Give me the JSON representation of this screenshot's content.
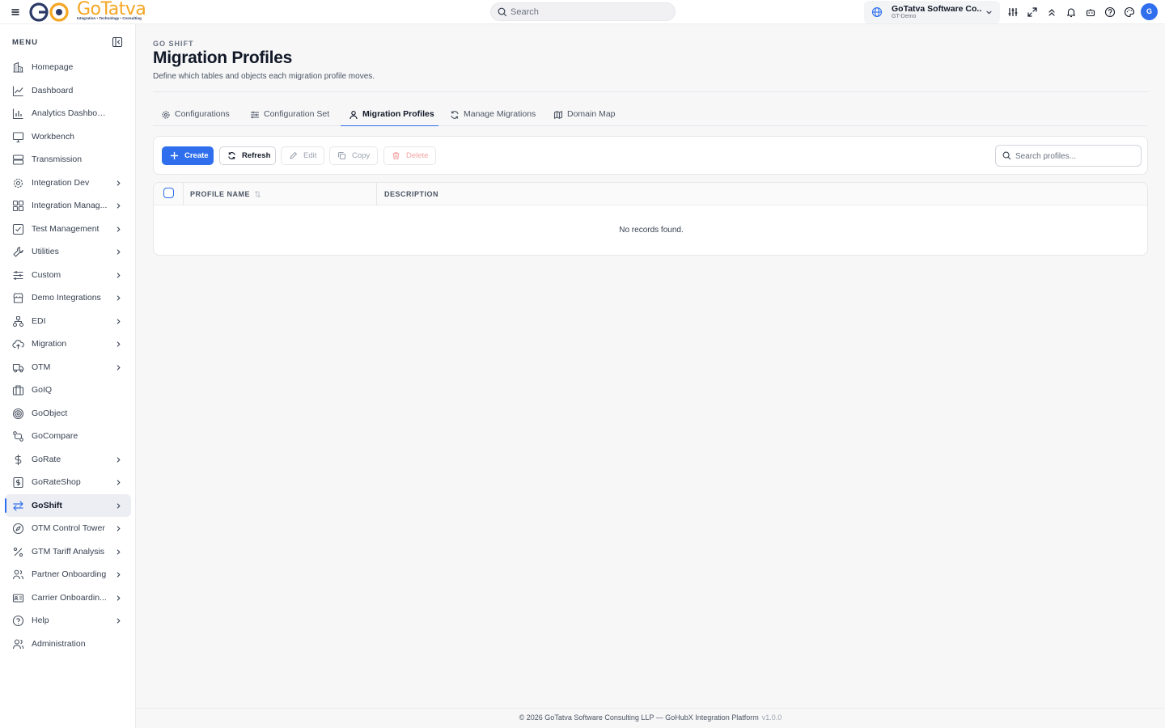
{
  "brand": {
    "logo_text": "GoTatva",
    "tagline": "Integration • Technology • Consulting",
    "accent": "#f5a623",
    "primary": "#2f6fed"
  },
  "topbar": {
    "search_placeholder": "Search",
    "org_name": "GoTatva Software Co...",
    "org_env": "GT-Demo",
    "avatar_initial": "G",
    "icons": [
      "sliders-icon",
      "expand-icon",
      "double-chevron-up-icon",
      "bell-icon",
      "robot-icon",
      "help-icon",
      "palette-icon"
    ]
  },
  "sidebar": {
    "title": "MENU",
    "items": [
      {
        "label": "Homepage",
        "icon": "building-icon",
        "expandable": false
      },
      {
        "label": "Dashboard",
        "icon": "line-chart-icon",
        "expandable": false
      },
      {
        "label": "Analytics Dashboard",
        "icon": "bar-chart-icon",
        "expandable": false
      },
      {
        "label": "Workbench",
        "icon": "monitor-icon",
        "expandable": false
      },
      {
        "label": "Transmission",
        "icon": "server-icon",
        "expandable": false
      },
      {
        "label": "Integration Dev",
        "icon": "gear-icon",
        "expandable": true
      },
      {
        "label": "Integration Manag...",
        "icon": "grid-icon",
        "expandable": true
      },
      {
        "label": "Test Management",
        "icon": "checkbox-icon",
        "expandable": true
      },
      {
        "label": "Utilities",
        "icon": "wrench-icon",
        "expandable": true
      },
      {
        "label": "Custom",
        "icon": "sliders-horizontal-icon",
        "expandable": true
      },
      {
        "label": "Demo Integrations",
        "icon": "store-icon",
        "expandable": true
      },
      {
        "label": "EDI",
        "icon": "network-icon",
        "expandable": true
      },
      {
        "label": "Migration",
        "icon": "cloud-upload-icon",
        "expandable": true
      },
      {
        "label": "OTM",
        "icon": "truck-icon",
        "expandable": true
      },
      {
        "label": "GoIQ",
        "icon": "briefcase-icon",
        "expandable": false
      },
      {
        "label": "GoObject",
        "icon": "target-icon",
        "expandable": false
      },
      {
        "label": "GoCompare",
        "icon": "git-compare-icon",
        "expandable": false
      },
      {
        "label": "GoRate",
        "icon": "dollar-icon",
        "expandable": true
      },
      {
        "label": "GoRateShop",
        "icon": "receipt-dollar-icon",
        "expandable": true
      },
      {
        "label": "GoShift",
        "icon": "arrows-swap-icon",
        "expandable": true,
        "active": true
      },
      {
        "label": "OTM Control Tower",
        "icon": "compass-icon",
        "expandable": true
      },
      {
        "label": "GTM Tariff Analysis",
        "icon": "percent-icon",
        "expandable": true
      },
      {
        "label": "Partner Onboarding",
        "icon": "users-icon",
        "expandable": true
      },
      {
        "label": "Carrier Onboardin...",
        "icon": "id-card-icon",
        "expandable": true
      },
      {
        "label": "Help",
        "icon": "help-circle-icon",
        "expandable": true
      },
      {
        "label": "Administration",
        "icon": "users-admin-icon",
        "expandable": false
      }
    ]
  },
  "page": {
    "eyebrow": "GO SHIFT",
    "title": "Migration Profiles",
    "subtitle": "Define which tables and objects each migration profile moves."
  },
  "tabs": [
    {
      "label": "Configurations",
      "icon": "cog-icon"
    },
    {
      "label": "Configuration Set",
      "icon": "sliders-horizontal-icon"
    },
    {
      "label": "Migration Profiles",
      "icon": "user-icon",
      "active": true
    },
    {
      "label": "Manage Migrations",
      "icon": "refresh-icon"
    },
    {
      "label": "Domain Map",
      "icon": "map-icon"
    }
  ],
  "toolbar": {
    "create": "Create",
    "refresh": "Refresh",
    "edit": "Edit",
    "copy": "Copy",
    "delete": "Delete",
    "search_placeholder": "Search profiles..."
  },
  "table": {
    "columns": [
      "PROFILE NAME",
      "DESCRIPTION"
    ],
    "rows": [],
    "empty_text": "No records found."
  },
  "footer": {
    "text": "© 2026 GoTatva Software Consulting LLP — GoHubX Integration Platform",
    "version": "v1.0.0"
  }
}
